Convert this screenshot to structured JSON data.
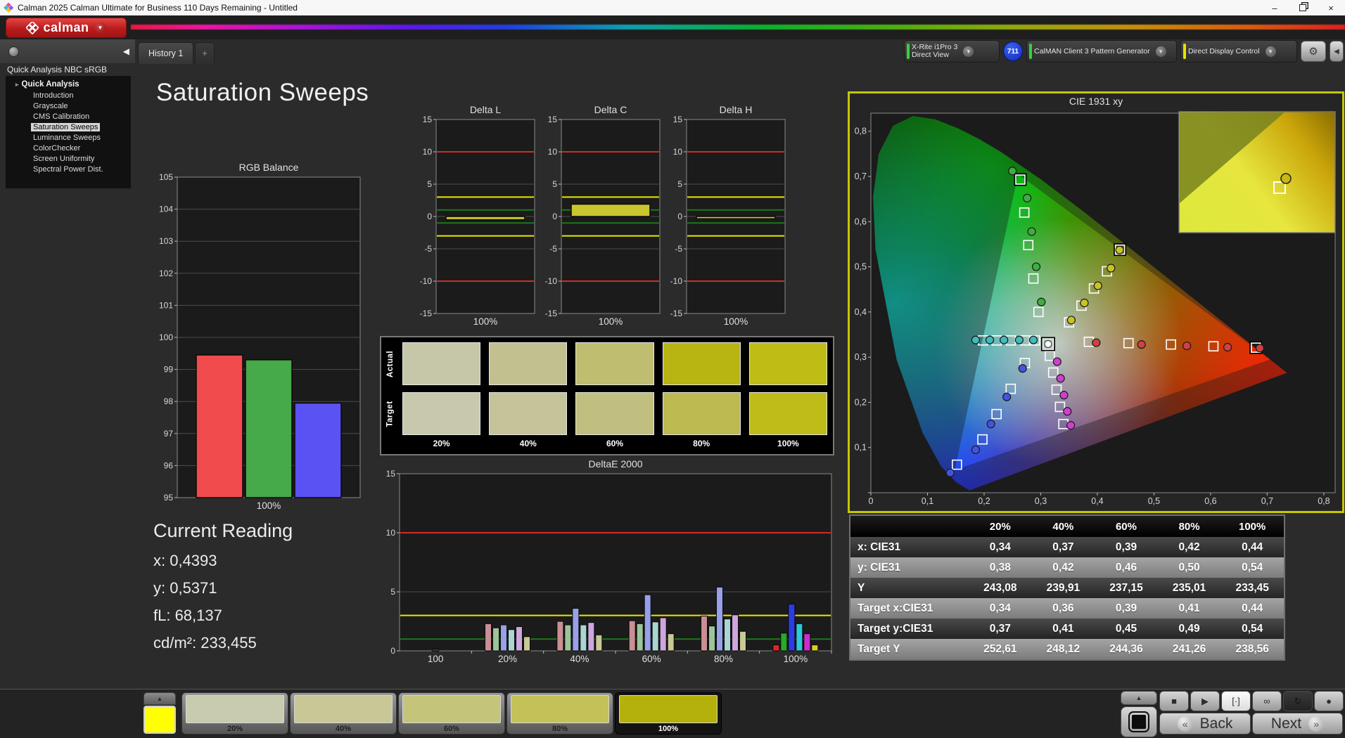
{
  "window": {
    "title": "Calman 2025 Calman Ultimate for Business 110 Days Remaining - Untitled",
    "minimize": "–",
    "close": "×"
  },
  "brand": {
    "logo_text": "calman"
  },
  "toolbar": {
    "tabs": [
      {
        "label": "History 1",
        "active": true
      },
      {
        "label": "+",
        "active": false
      }
    ],
    "meter": {
      "line1": "X-Rite i1Pro 3",
      "line2": "Direct View",
      "accent": "#35d435"
    },
    "meter_badge": "711",
    "pattern_source": {
      "label": "CalMAN Client 3 Pattern Generator",
      "accent": "#35d435"
    },
    "display_control": {
      "label": "Direct Display Control",
      "accent": "#e2e200"
    },
    "settings_icon": "gear-icon"
  },
  "sidebar": {
    "title": "Quick Analysis NBC sRGB",
    "root": "Quick Analysis",
    "items": [
      "Introduction",
      "Grayscale",
      "CMS Calibration",
      "Saturation Sweeps",
      "Luminance Sweeps",
      "ColorChecker",
      "Screen Uniformity",
      "Spectral Power Dist."
    ],
    "selected_index": 3
  },
  "page": {
    "title": "Saturation Sweeps"
  },
  "current_reading": {
    "title": "Current Reading",
    "lines": [
      "x: 0,4393",
      "y: 0,5371",
      "fL: 68,137",
      "cd/m²: 233,455"
    ]
  },
  "chart_data": [
    {
      "id": "rgb_balance",
      "type": "bar",
      "title": "RGB Balance",
      "categories": [
        "100%"
      ],
      "ylim": [
        95,
        105
      ],
      "ytick": 1,
      "series": [
        {
          "name": "Red",
          "color": "#f14b4d",
          "values": [
            99.45
          ]
        },
        {
          "name": "Green",
          "color": "#46a94a",
          "values": [
            99.3
          ]
        },
        {
          "name": "Blue",
          "color": "#5a52f2",
          "values": [
            97.95
          ]
        }
      ]
    },
    {
      "id": "delta_l",
      "type": "delta-bar",
      "title": "Delta L",
      "categories": [
        "100%"
      ],
      "values": [
        -0.5
      ],
      "ylim": [
        -15,
        15
      ],
      "ytick": 5,
      "limits": {
        "red": 10,
        "yellow": 3,
        "green": 1
      },
      "bar_color": "#c9c62f"
    },
    {
      "id": "delta_c",
      "type": "delta-bar",
      "title": "Delta C",
      "categories": [
        "100%"
      ],
      "values": [
        1.9
      ],
      "ylim": [
        -15,
        15
      ],
      "ytick": 5,
      "limits": {
        "red": 10,
        "yellow": 3,
        "green": 1
      },
      "bar_color": "#c9c62f"
    },
    {
      "id": "delta_h",
      "type": "delta-bar",
      "title": "Delta H",
      "categories": [
        "100%"
      ],
      "values": [
        -0.35
      ],
      "ylim": [
        -15,
        15
      ],
      "ytick": 5,
      "limits": {
        "red": 10,
        "yellow": 3,
        "green": 1
      },
      "bar_color": "#c9c62f"
    },
    {
      "id": "deltae2000",
      "type": "grouped-bar",
      "title": "DeltaE 2000",
      "categories": [
        "100",
        "20%",
        "40%",
        "60%",
        "80%",
        "100%"
      ],
      "ylim": [
        0,
        15
      ],
      "ytick": 5,
      "limits": {
        "red": 10,
        "yellow": 3,
        "green": 1
      },
      "groups": [
        {
          "values": [
            0.15
          ],
          "colors": [
            "#484848"
          ]
        },
        {
          "values": [
            2.3,
            1.95,
            2.2,
            1.8,
            2.05,
            1.2
          ],
          "colors": [
            "#c98f93",
            "#9cc49a",
            "#97a0e8",
            "#a9d6d2",
            "#cfa6dd",
            "#c9c795"
          ]
        },
        {
          "values": [
            2.5,
            2.2,
            3.6,
            2.2,
            2.4,
            1.35
          ],
          "colors": [
            "#c98f93",
            "#9cc49a",
            "#97a0e8",
            "#a9d6d2",
            "#cfa6dd",
            "#c9c795"
          ]
        },
        {
          "values": [
            2.55,
            2.3,
            4.75,
            2.45,
            2.8,
            1.45
          ],
          "colors": [
            "#c98f93",
            "#9cc49a",
            "#97a0e8",
            "#a9d6d2",
            "#cfa6dd",
            "#c9c795"
          ]
        },
        {
          "values": [
            2.95,
            2.1,
            5.4,
            2.7,
            3.05,
            1.65
          ],
          "colors": [
            "#c98f93",
            "#9cc49a",
            "#97a0e8",
            "#a9d6d2",
            "#cfa6dd",
            "#c9c795"
          ]
        },
        {
          "values": [
            0.5,
            1.5,
            3.95,
            2.3,
            1.45,
            0.5
          ],
          "colors": [
            "#de2626",
            "#2aa82a",
            "#2d3ce2",
            "#2bc9d9",
            "#ce2bce",
            "#dacc24"
          ]
        }
      ]
    },
    {
      "id": "cie1931",
      "type": "cie-scatter",
      "title": "CIE 1931 xy",
      "xlim": [
        0,
        0.8
      ],
      "ylim": [
        0,
        0.8
      ],
      "tick": 0.1,
      "gamut_triangle": [
        [
          0.705,
          0.295
        ],
        [
          0.26,
          0.705
        ],
        [
          0.148,
          0.05
        ]
      ],
      "white_point": {
        "target": [
          0.313,
          0.329
        ]
      },
      "sweeps": [
        {
          "name": "red",
          "color": "#d24040",
          "emph_last": true,
          "targets": [
            [
              0.385,
              0.334
            ],
            [
              0.455,
              0.331
            ],
            [
              0.53,
              0.328
            ],
            [
              0.605,
              0.324
            ],
            [
              0.68,
              0.321
            ]
          ],
          "measured": [
            [
              0.398,
              0.332
            ],
            [
              0.478,
              0.328
            ],
            [
              0.558,
              0.325
            ],
            [
              0.63,
              0.322
            ],
            [
              0.687,
              0.32
            ]
          ]
        },
        {
          "name": "green",
          "color": "#3fae3f",
          "emph_last": true,
          "targets": [
            [
              0.296,
              0.4
            ],
            [
              0.287,
              0.474
            ],
            [
              0.278,
              0.548
            ],
            [
              0.271,
              0.62
            ],
            [
              0.264,
              0.693
            ]
          ],
          "measured": [
            [
              0.301,
              0.422
            ],
            [
              0.292,
              0.5
            ],
            [
              0.284,
              0.578
            ],
            [
              0.276,
              0.652
            ],
            [
              0.25,
              0.712
            ]
          ]
        },
        {
          "name": "blue",
          "color": "#4653de",
          "emph_last": false,
          "targets": [
            [
              0.272,
              0.287
            ],
            [
              0.247,
              0.23
            ],
            [
              0.222,
              0.174
            ],
            [
              0.197,
              0.118
            ],
            [
              0.152,
              0.062
            ]
          ],
          "measured": [
            [
              0.268,
              0.275
            ],
            [
              0.24,
              0.212
            ],
            [
              0.212,
              0.152
            ],
            [
              0.185,
              0.095
            ],
            [
              0.14,
              0.044
            ]
          ]
        },
        {
          "name": "cyan",
          "color": "#3fbcbc",
          "emph_last": false,
          "targets": [
            [
              0.29,
              0.337
            ],
            [
              0.272,
              0.337
            ],
            [
              0.247,
              0.337
            ],
            [
              0.222,
              0.337
            ],
            [
              0.198,
              0.337
            ]
          ],
          "measured": [
            [
              0.287,
              0.338
            ],
            [
              0.262,
              0.338
            ],
            [
              0.235,
              0.338
            ],
            [
              0.21,
              0.338
            ],
            [
              0.185,
              0.338
            ]
          ]
        },
        {
          "name": "magenta",
          "color": "#cf3fcf",
          "emph_last": false,
          "targets": [
            [
              0.316,
              0.303
            ],
            [
              0.322,
              0.266
            ],
            [
              0.328,
              0.228
            ],
            [
              0.334,
              0.19
            ],
            [
              0.34,
              0.152
            ]
          ],
          "measured": [
            [
              0.329,
              0.29
            ],
            [
              0.335,
              0.253
            ],
            [
              0.341,
              0.216
            ],
            [
              0.347,
              0.18
            ],
            [
              0.353,
              0.149
            ]
          ]
        },
        {
          "name": "yellow",
          "color": "#c9c325",
          "emph_last": true,
          "targets": [
            [
              0.35,
              0.377
            ],
            [
              0.372,
              0.414
            ],
            [
              0.394,
              0.452
            ],
            [
              0.417,
              0.49
            ],
            [
              0.44,
              0.538
            ]
          ],
          "measured": [
            [
              0.354,
              0.382
            ],
            [
              0.377,
              0.42
            ],
            [
              0.401,
              0.458
            ],
            [
              0.424,
              0.497
            ],
            [
              0.4393,
              0.5371
            ]
          ]
        }
      ]
    }
  ],
  "swatches": {
    "columns": [
      "20%",
      "40%",
      "60%",
      "80%",
      "100%"
    ],
    "rows": [
      {
        "label": "Actual",
        "colors": [
          "#c6c6a9",
          "#c2c08f",
          "#bfbd6f",
          "#b8b512",
          "#bfbc15"
        ]
      },
      {
        "label": "Target",
        "colors": [
          "#c8c8ad",
          "#c4c39a",
          "#c0bf7f",
          "#bcba50",
          "#bfbc1a"
        ]
      }
    ]
  },
  "results_table": {
    "header": [
      "",
      "20%",
      "40%",
      "60%",
      "80%",
      "100%"
    ],
    "rows": [
      [
        "x: CIE31",
        "0,34",
        "0,37",
        "0,39",
        "0,42",
        "0,44"
      ],
      [
        "y: CIE31",
        "0,38",
        "0,42",
        "0,46",
        "0,50",
        "0,54"
      ],
      [
        "Y",
        "243,08",
        "239,91",
        "237,15",
        "235,01",
        "233,45"
      ],
      [
        "Target x:CIE31",
        "0,34",
        "0,36",
        "0,39",
        "0,41",
        "0,44"
      ],
      [
        "Target y:CIE31",
        "0,37",
        "0,41",
        "0,45",
        "0,49",
        "0,54"
      ],
      [
        "Target Y",
        "252,61",
        "248,12",
        "244,36",
        "241,26",
        "238,56"
      ]
    ]
  },
  "pattern_bar": {
    "current_color": "#ffff00",
    "buttons": [
      {
        "label": "20%",
        "color": "#c9cbae"
      },
      {
        "label": "40%",
        "color": "#c9c795"
      },
      {
        "label": "60%",
        "color": "#c5c47b"
      },
      {
        "label": "80%",
        "color": "#c4c158"
      },
      {
        "label": "100%",
        "color": "#b5b10c"
      }
    ],
    "selected": "100%"
  },
  "transport": {
    "back": "Back",
    "next": "Next",
    "icons": [
      "stop-icon",
      "play-icon",
      "pattern-window-icon",
      "loop-infinite-icon",
      "sync-icon",
      "blank-icon"
    ]
  }
}
